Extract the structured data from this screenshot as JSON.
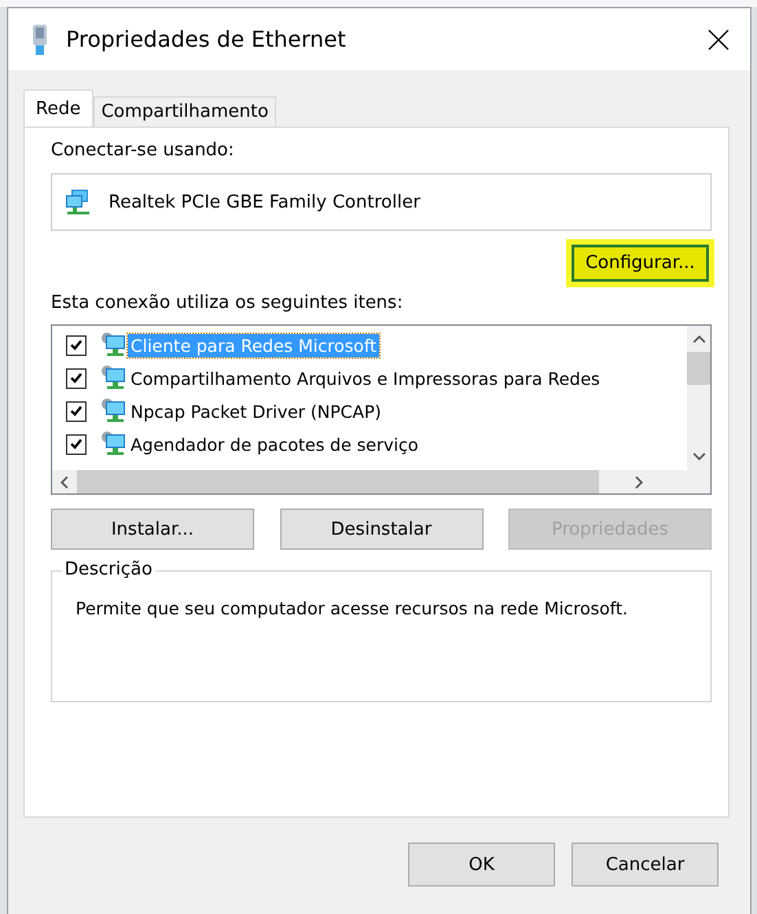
{
  "window": {
    "title": "Propriedades de Ethernet"
  },
  "tabs": [
    {
      "label": "Rede",
      "selected": true
    },
    {
      "label": "Compartilhamento",
      "selected": false
    }
  ],
  "connect": {
    "label": "Conectar-se usando:",
    "adapter": "Realtek PCIe GBE Family Controller",
    "configure_button": {
      "label": "Configurar...",
      "highlighted": true
    }
  },
  "items": {
    "label": "Esta conexão utiliza os seguintes itens:",
    "rows": [
      {
        "label": "Cliente para Redes Microsoft",
        "checked": true,
        "selected": true
      },
      {
        "label": "Compartilhamento Arquivos e Impressoras para Redes",
        "checked": true,
        "selected": false
      },
      {
        "label": "Npcap Packet Driver (NPCAP)",
        "checked": true,
        "selected": false
      },
      {
        "label": "Agendador de pacotes de serviço",
        "checked": true,
        "selected": false
      }
    ]
  },
  "item_buttons": [
    {
      "label": "Instalar...",
      "disabled": false
    },
    {
      "label": "Desinstalar",
      "disabled": false
    },
    {
      "label": "Propriedades",
      "disabled": true
    }
  ],
  "description": {
    "title": "Descrição",
    "text": "Permite que seu computador acesse recursos na rede Microsoft."
  },
  "dialog_buttons": [
    "OK",
    "Cancelar"
  ]
}
